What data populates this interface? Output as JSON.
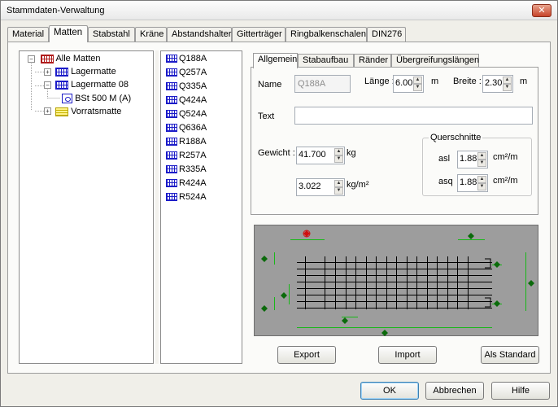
{
  "window": {
    "title": "Stammdaten-Verwaltung",
    "close_glyph": "✕"
  },
  "tabs": [
    {
      "label": "Material"
    },
    {
      "label": "Matten"
    },
    {
      "label": "Stabstahl"
    },
    {
      "label": "Kräne"
    },
    {
      "label": "Abstandshalter"
    },
    {
      "label": "Gitterträger"
    },
    {
      "label": "Ringbalkenschalen"
    },
    {
      "label": "DIN276"
    }
  ],
  "active_tab": "Matten",
  "tree": {
    "root": {
      "label": "Alle Matten",
      "icon": "mesh-icon-red",
      "expander": "−"
    },
    "lagermatte": {
      "label": "Lagermatte",
      "icon": "mesh-icon",
      "expander": "+"
    },
    "lagermatte08": {
      "label": "Lagermatte 08",
      "icon": "mesh-icon",
      "expander": "−"
    },
    "bst": {
      "label": "BSt 500 M (A)",
      "icon": "steel-grade-icon"
    },
    "vorratsmatte": {
      "label": "Vorratsmatte",
      "icon": "mesh-icon-yellow",
      "expander": "+"
    }
  },
  "mat_list": [
    "Q188A",
    "Q257A",
    "Q335A",
    "Q424A",
    "Q524A",
    "Q636A",
    "R188A",
    "R257A",
    "R335A",
    "R424A",
    "R524A"
  ],
  "subtabs": [
    {
      "label": "Allgemein"
    },
    {
      "label": "Stabaufbau"
    },
    {
      "label": "Ränder"
    },
    {
      "label": "Übergreifungslängen"
    }
  ],
  "form": {
    "name_label": "Name",
    "name_value": "Q188A",
    "laenge_label": "Länge :",
    "laenge_value": "6.00",
    "laenge_unit": "m",
    "breite_label": "Breite :",
    "breite_value": "2.30",
    "breite_unit": "m",
    "text_label": "Text",
    "text_value": "",
    "gewicht_label": "Gewicht :",
    "gewicht_value": "41.700",
    "gewicht_unit": "kg",
    "flaeche_value": "3.022",
    "flaeche_unit": "kg/m²",
    "querschnitte_title": "Querschnitte",
    "asl_label": "asl",
    "asl_value": "1.88",
    "asl_unit": "cm²/m",
    "asq_label": "asq",
    "asq_value": "1.88",
    "asq_unit": "cm²/m"
  },
  "buttons": {
    "export": "Export",
    "import": "Import",
    "standard": "Als Standard",
    "ok": "OK",
    "abbrechen": "Abbrechen",
    "hilfe": "Hilfe"
  },
  "colors": {
    "preview_bg": "#9d9d9d",
    "mesh_lines": "#000000",
    "dimension_lines": "#18b818",
    "handle_fill": "#0b6a0b",
    "selected_handle": "#d01010"
  }
}
